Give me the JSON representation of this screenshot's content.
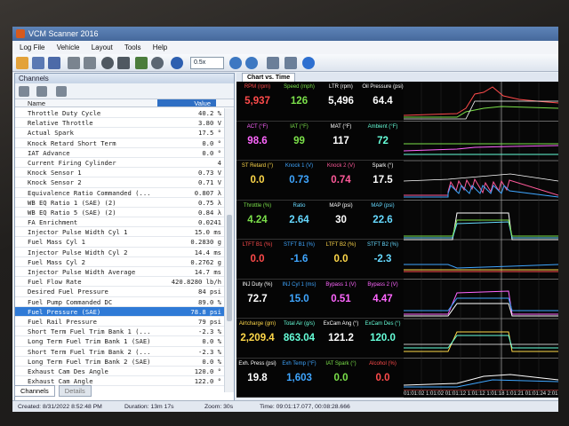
{
  "window": {
    "title": "VCM Scanner 2016"
  },
  "menu": [
    "Log File",
    "Vehicle",
    "Layout",
    "Tools",
    "Help"
  ],
  "toolbar": {
    "zoom_value": "0.5x"
  },
  "channels_panel": {
    "title": "Channels",
    "col_name": "Name",
    "col_value": "Value",
    "rows": [
      {
        "name": "Throttle Duty Cycle",
        "value": "40.2 %"
      },
      {
        "name": "Relative Throttle",
        "value": "3.80 V"
      },
      {
        "name": "Actual Spark",
        "value": "17.5 °"
      },
      {
        "name": "Knock Retard Short Term",
        "value": "0.0 °"
      },
      {
        "name": "IAT Advance",
        "value": "0.0 °"
      },
      {
        "name": "Current Firing Cylinder",
        "value": "4"
      },
      {
        "name": "Knock Sensor 1",
        "value": "0.73 V"
      },
      {
        "name": "Knock Sensor 2",
        "value": "0.71 V"
      },
      {
        "name": "Equivalence Ratio Commanded (...",
        "value": "0.807 λ"
      },
      {
        "name": "WB EQ Ratio 1 (SAE) (2)",
        "value": "0.75 λ"
      },
      {
        "name": "WB EQ Ratio 5 (SAE) (2)",
        "value": "0.84 λ"
      },
      {
        "name": "FA Enrichment",
        "value": "0.0241"
      },
      {
        "name": "Injector Pulse Width Cyl 1",
        "value": "15.0 ms"
      },
      {
        "name": "Fuel Mass Cyl 1",
        "value": "0.2830 g"
      },
      {
        "name": "Injector Pulse Width Cyl 2",
        "value": "14.4 ms"
      },
      {
        "name": "Fuel Mass Cyl 2",
        "value": "0.2762 g"
      },
      {
        "name": "Injector Pulse Width Average",
        "value": "14.7 ms"
      },
      {
        "name": "Fuel Flow Rate",
        "value": "420.8280 lb/h"
      },
      {
        "name": "Desired Fuel Pressure",
        "value": "84 psi"
      },
      {
        "name": "Fuel Pump Commanded DC",
        "value": "89.0 %"
      },
      {
        "name": "Fuel Pressure (SAE)",
        "value": "78.8 psi",
        "selected": true
      },
      {
        "name": "Fuel Rail Pressure",
        "value": "79 psi"
      },
      {
        "name": "Short Term Fuel Trim Bank 1 (...",
        "value": "-2.3 %"
      },
      {
        "name": "Long Term Fuel Trim Bank 1 (SAE)",
        "value": "0.0 %"
      },
      {
        "name": "Short Term Fuel Trim Bank 2 (...",
        "value": "-2.3 %"
      },
      {
        "name": "Long Term Fuel Trim Bank 2 (SAE)",
        "value": "0.0 %"
      },
      {
        "name": "Exhaust Cam Des Angle",
        "value": "120.0 °"
      },
      {
        "name": "Exhaust Cam Angle",
        "value": "122.0 °"
      }
    ],
    "tabs": [
      "Channels",
      "Details"
    ]
  },
  "chart_tab": "Chart vs. Time",
  "gauge_rows": [
    [
      {
        "label": "RPM (rpm)",
        "value": "5,937",
        "color": "#ff4b4b"
      },
      {
        "label": "Speed (mph)",
        "value": "126",
        "color": "#7be04a"
      },
      {
        "label": "LTR (rpm)",
        "value": "5,496",
        "color": "#ffffff"
      },
      {
        "label": "Oil Pressure (psi)",
        "value": "64.4",
        "color": "#ffffff"
      }
    ],
    [
      {
        "label": "ACT (°F)",
        "value": "98.6",
        "color": "#ff66ff"
      },
      {
        "label": "IAT (°F)",
        "value": "99",
        "color": "#7be04a"
      },
      {
        "label": "MAT (°F)",
        "value": "117",
        "color": "#ffffff"
      },
      {
        "label": "Ambient (°F)",
        "value": "72",
        "color": "#66ffd9"
      }
    ],
    [
      {
        "label": "ST Retard (°)",
        "value": "0.0",
        "color": "#ffd84a"
      },
      {
        "label": "Knock 1 (V)",
        "value": "0.73",
        "color": "#3fa6ff"
      },
      {
        "label": "Knock 2 (V)",
        "value": "0.74",
        "color": "#ff5a9a"
      },
      {
        "label": "Spark (°)",
        "value": "17.5",
        "color": "#ffffff"
      }
    ],
    [
      {
        "label": "Throttle (%)",
        "value": "4.24",
        "color": "#7be04a"
      },
      {
        "label": "Ratio",
        "value": "2.64",
        "color": "#66d9ff"
      },
      {
        "label": "MAP (psi)",
        "value": "30",
        "color": "#ffffff"
      },
      {
        "label": "MAP (psi)",
        "value": "22.6",
        "color": "#66d9ff"
      }
    ],
    [
      {
        "label": "LTFT B1 (%)",
        "value": "0.0",
        "color": "#ff4b4b"
      },
      {
        "label": "STFT B1 (%)",
        "value": "-1.6",
        "color": "#3fa6ff"
      },
      {
        "label": "LTFT B2 (%)",
        "value": "0.0",
        "color": "#ffd84a"
      },
      {
        "label": "STFT B2 (%)",
        "value": "-2.3",
        "color": "#66d9ff"
      }
    ],
    [
      {
        "label": "INJ Duty (%)",
        "value": "72.7",
        "color": "#ffffff"
      },
      {
        "label": "INJ Cyl 1 (ms)",
        "value": "15.0",
        "color": "#3fa6ff"
      },
      {
        "label": "Bypass 1 (V)",
        "value": "0.51",
        "color": "#ff66ff"
      },
      {
        "label": "Bypass 2 (V)",
        "value": "4.47",
        "color": "#ff66ff"
      }
    ],
    [
      {
        "label": "Airtcharge (gm)",
        "value": "2,209.4",
        "color": "#ffd84a"
      },
      {
        "label": "Total Air (g/s)",
        "value": "863.04",
        "color": "#66ffd9"
      },
      {
        "label": "ExCam Ang (°)",
        "value": "121.2",
        "color": "#ffffff"
      },
      {
        "label": "ExCam Des (°)",
        "value": "120.0",
        "color": "#66ffd9"
      }
    ],
    [
      {
        "label": "Exh. Press (psi)",
        "value": "19.8",
        "color": "#ffffff"
      },
      {
        "label": "Exh Temp (°F)",
        "value": "1,603",
        "color": "#3fa6ff"
      },
      {
        "label": "IAT Spark (°)",
        "value": "0.0",
        "color": "#7be04a"
      },
      {
        "label": "Alcohol (%)",
        "value": "0.0",
        "color": "#ff4b4b"
      }
    ]
  ],
  "time_ticks": "01:01:02 1:01:02 01:01:12 1:01:12 1:01:18 1:01:21 01:01:24 2:01:01",
  "status": {
    "created": "Created: 8/31/2022 8:52:48 PM",
    "duration": "Duration: 13m 17s",
    "zoom": "Zoom: 30s",
    "time": "Time: 09:01:17.077, 00:08:28.666"
  }
}
